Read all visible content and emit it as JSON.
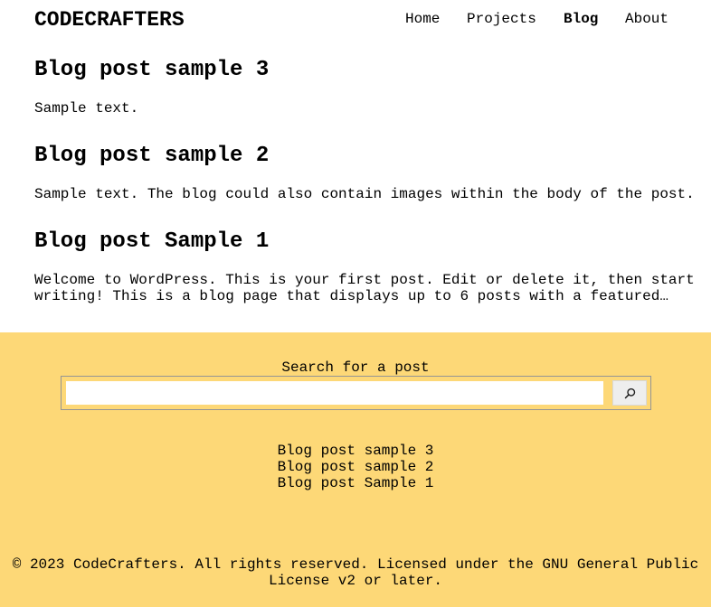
{
  "header": {
    "site_title": "CODECRAFTERS",
    "nav": [
      "Home",
      "Projects",
      "Blog",
      "About"
    ],
    "active_nav": "Blog"
  },
  "posts": [
    {
      "title": "Blog post sample 3",
      "excerpt": "Sample text."
    },
    {
      "title": "Blog post sample 2",
      "excerpt": "Sample text. The blog could also contain images within the body of the post."
    },
    {
      "title": "Blog post Sample 1",
      "excerpt": "Welcome to WordPress. This is your first post. Edit or delete it, then start\nwriting! This is a blog page that displays up to 6 posts with a featured…"
    }
  ],
  "footer": {
    "search_label": "Search for a post",
    "search_value": "",
    "search_button_icon": "search-icon",
    "links": [
      "Blog post sample 3",
      "Blog post sample 2",
      "Blog post Sample 1"
    ],
    "copyright": "© 2023 CodeCrafters. All rights reserved. Licensed under the GNU General Public License v2 or later.",
    "background_color": "#fdd877"
  }
}
